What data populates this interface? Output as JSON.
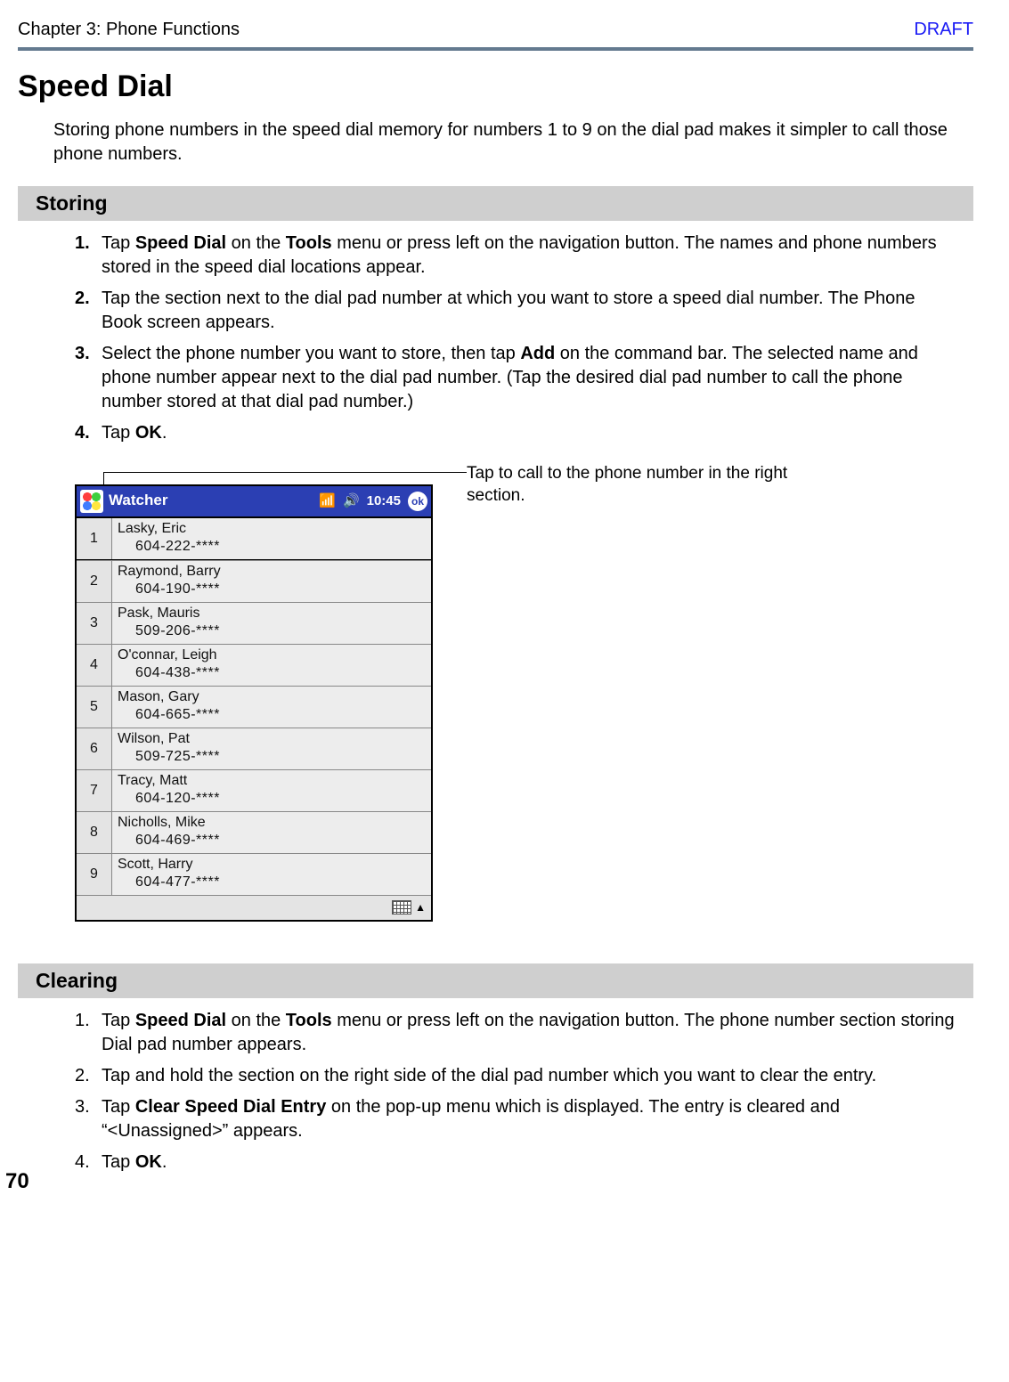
{
  "header": {
    "chapter": "Chapter 3: Phone Functions",
    "draft": "DRAFT"
  },
  "title": "Speed Dial",
  "intro": "Storing phone numbers in the speed dial memory for numbers 1 to 9 on the dial pad makes it simpler to call those phone numbers.",
  "storing": {
    "heading": "Storing",
    "steps": [
      {
        "n": "1.",
        "pre": "Tap ",
        "b1": "Speed Dial",
        "mid": " on the ",
        "b2": "Tools",
        "post": " menu or press left on the navigation button. The names and phone numbers stored in the speed dial locations appear."
      },
      {
        "n": "2.",
        "pre": "Tap the section next to the dial pad number at which you want to store a speed dial number. The Phone Book screen appears."
      },
      {
        "n": "3.",
        "pre": "Select the phone number you want to store, then tap ",
        "b1": "Add",
        "post": " on the command bar. The selected name and phone number appear next to the dial pad number. (Tap the desired dial pad number to call the phone number stored at that dial pad number.)"
      },
      {
        "n": "4.",
        "pre": "Tap ",
        "b1": "OK",
        "post": "."
      }
    ]
  },
  "callout": "Tap to call to the phone number in the right section.",
  "device": {
    "title": "Watcher",
    "time": "10:45",
    "ok": "ok",
    "entries": [
      {
        "num": "1",
        "name": "Lasky, Eric",
        "phone": "604-222-****"
      },
      {
        "num": "2",
        "name": "Raymond, Barry",
        "phone": "604-190-****"
      },
      {
        "num": "3",
        "name": "Pask, Mauris",
        "phone": "509-206-****"
      },
      {
        "num": "4",
        "name": "O'connar, Leigh",
        "phone": "604-438-****"
      },
      {
        "num": "5",
        "name": "Mason, Gary",
        "phone": "604-665-****"
      },
      {
        "num": "6",
        "name": "Wilson, Pat",
        "phone": "509-725-****"
      },
      {
        "num": "7",
        "name": "Tracy, Matt",
        "phone": "604-120-****"
      },
      {
        "num": "8",
        "name": "Nicholls, Mike",
        "phone": "604-469-****"
      },
      {
        "num": "9",
        "name": "Scott, Harry",
        "phone": "604-477-****"
      }
    ]
  },
  "clearing": {
    "heading": "Clearing",
    "steps": [
      {
        "n": "1.",
        "pre": "Tap ",
        "b1": "Speed Dial",
        "mid": " on the ",
        "b2": "Tools",
        "post": " menu or press left on the navigation button. The phone number section storing Dial pad number appears."
      },
      {
        "n": "2.",
        "pre": "Tap and hold the section on the right side of the dial pad number which you want to clear the entry."
      },
      {
        "n": "3.",
        "pre": "Tap ",
        "b1": "Clear Speed Dial Entry",
        "post": " on the pop-up menu which is displayed. The entry is cleared and “<Unassigned>” appears."
      },
      {
        "n": "4.",
        "pre": "Tap ",
        "b1": "OK",
        "post": "."
      }
    ]
  },
  "page": "70"
}
